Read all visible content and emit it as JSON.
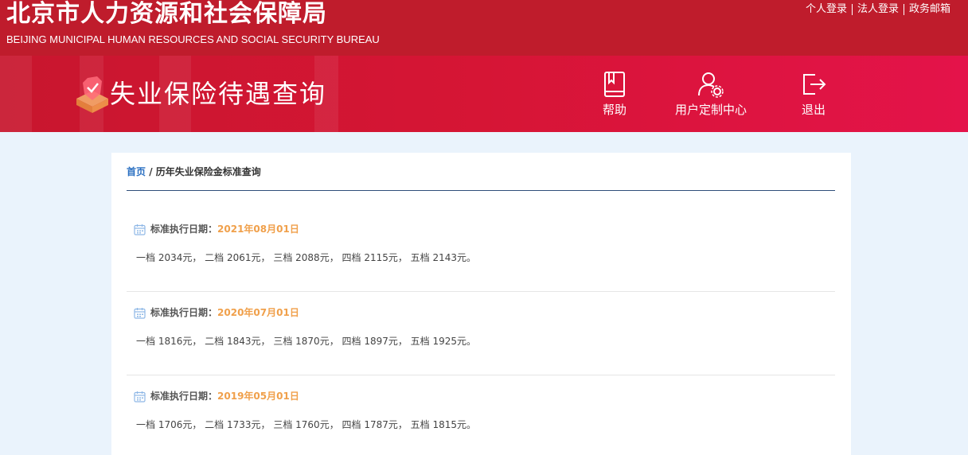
{
  "header": {
    "bureau_name_cn": "北京市人力资源和社会保障局",
    "bureau_name_en": "BEIJING MUNICIPAL HUMAN RESOURCES AND SOCIAL SECURITY BUREAU",
    "links": [
      "个人登录",
      "法人登录",
      "政务邮箱"
    ]
  },
  "banner": {
    "title": "失业保险待遇查询",
    "nav": [
      {
        "label": "帮助",
        "icon": "book-icon"
      },
      {
        "label": "用户定制中心",
        "icon": "user-settings-icon"
      },
      {
        "label": "退出",
        "icon": "logout-icon"
      }
    ]
  },
  "breadcrumb": {
    "home": "首页",
    "separator": "/",
    "current": "历年失业保险金标准查询"
  },
  "records": [
    {
      "label": "标准执行日期：",
      "date": "2021年08月01日",
      "values": "一档 2034元， 二档 2061元， 三档 2088元， 四档 2115元， 五档 2143元。"
    },
    {
      "label": "标准执行日期：",
      "date": "2020年07月01日",
      "values": "一档 1816元， 二档 1843元， 三档 1870元， 四档 1897元， 五档 1925元。"
    },
    {
      "label": "标准执行日期：",
      "date": "2019年05月01日",
      "values": "一档 1706元， 二档 1733元， 三档 1760元， 四档 1787元， 五档 1815元。"
    }
  ],
  "colors": {
    "header_red": "#bf1c2c",
    "banner_red": "#d61535",
    "date_orange": "#f0a04b",
    "link_blue": "#2a6fc1",
    "page_bg": "#eaf3fc"
  }
}
